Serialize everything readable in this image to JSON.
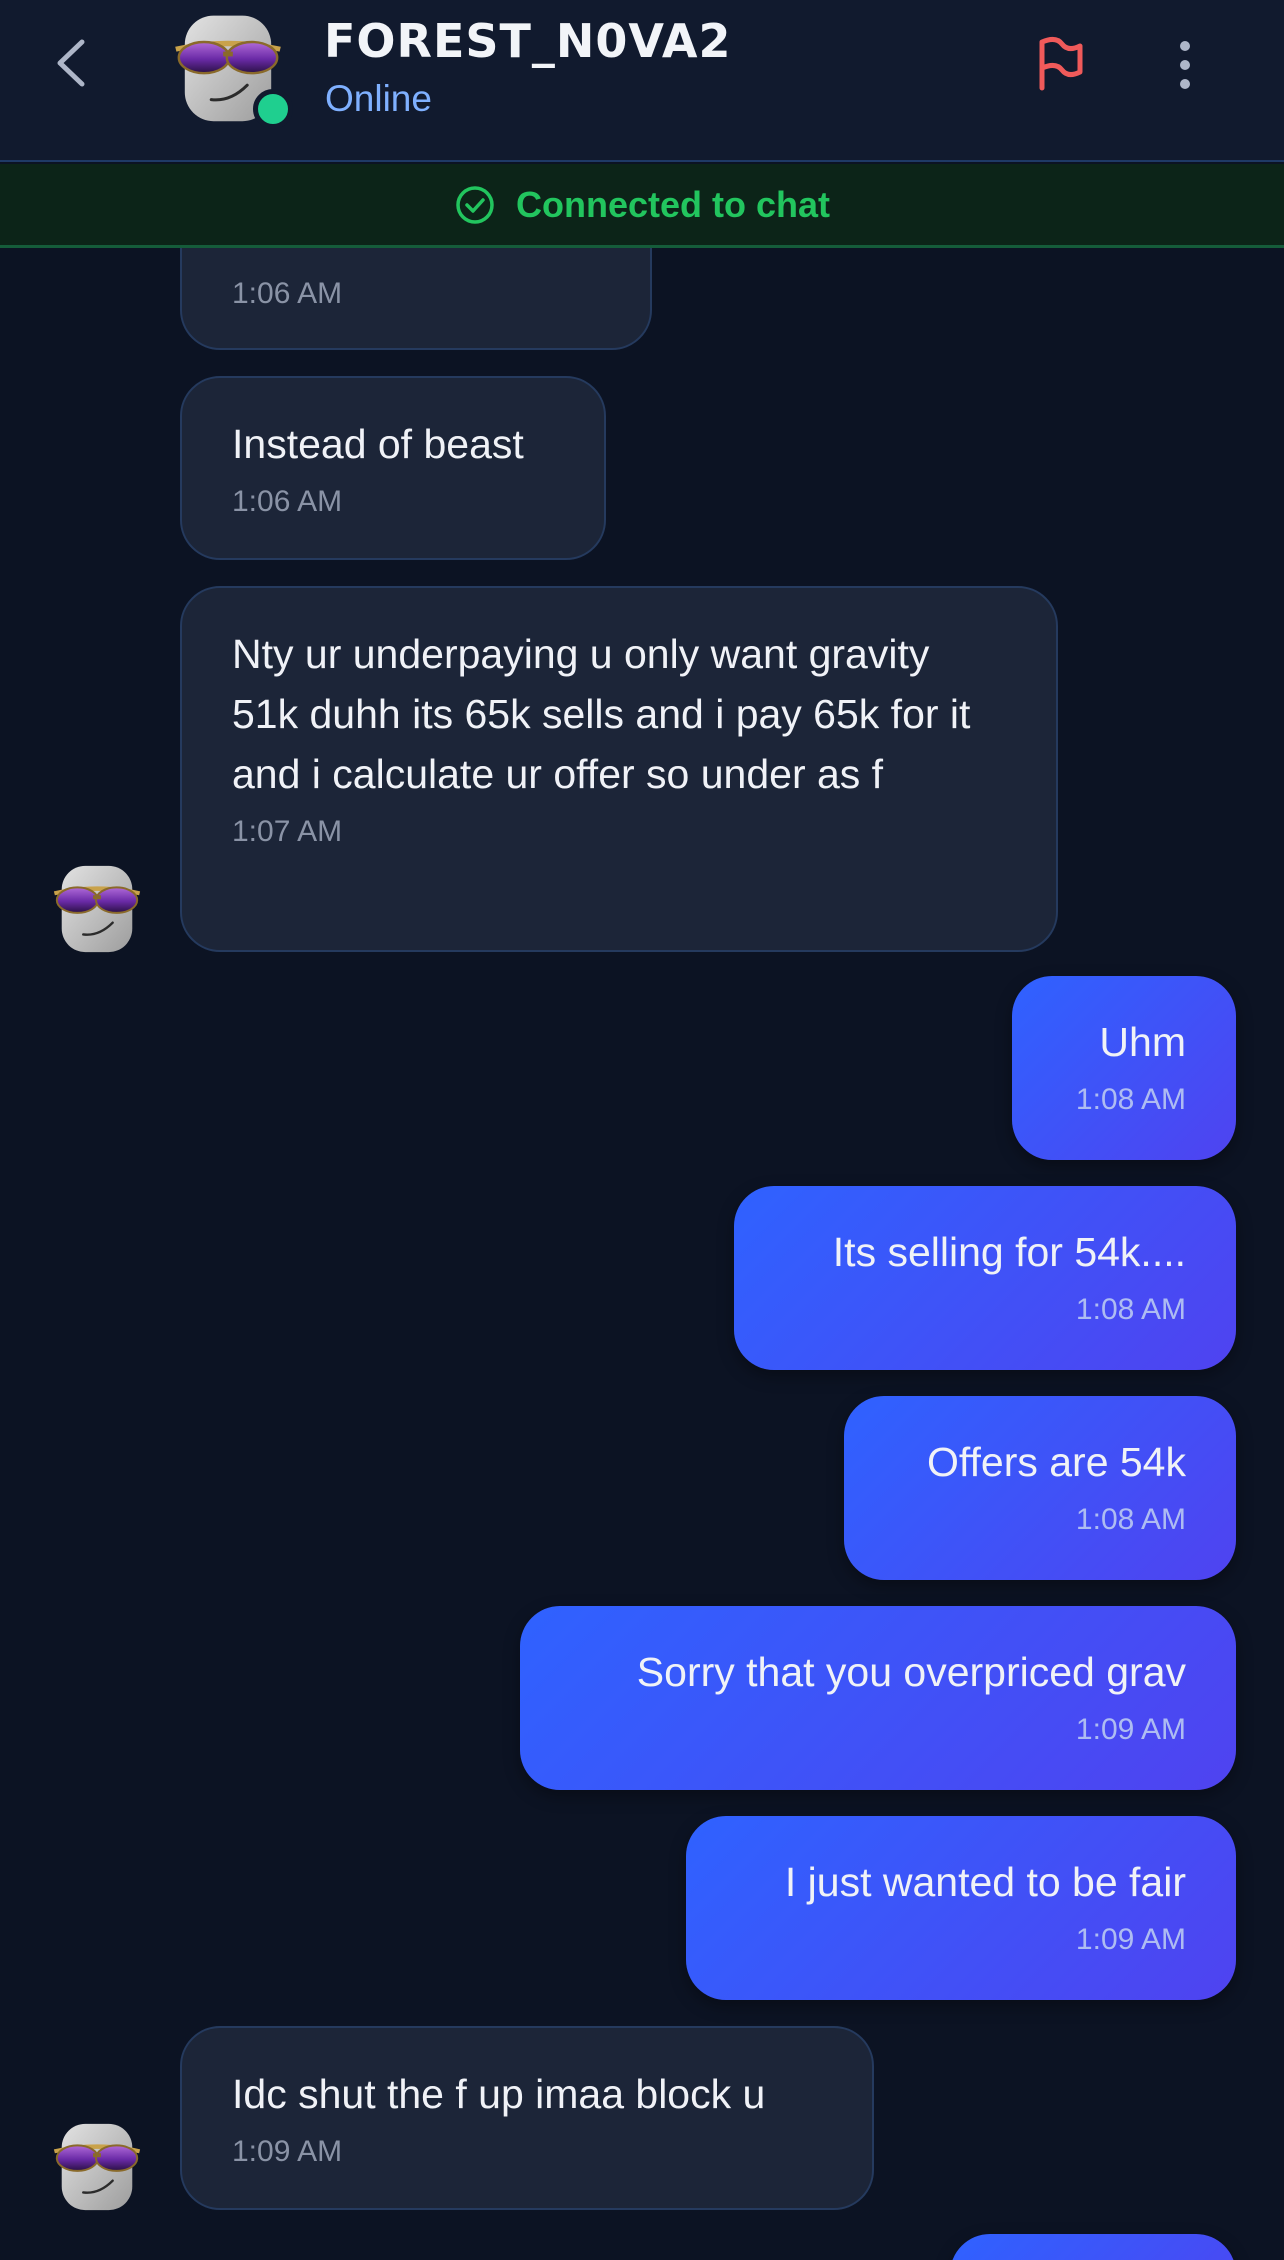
{
  "header": {
    "username": "FOREST_N0VA2",
    "status": "Online",
    "colors": {
      "online": "#1fcf8f",
      "status_text": "#7fb0ff",
      "flag": "#f05a5a"
    }
  },
  "banner": {
    "text": "Connected to chat",
    "color": "#22c55e"
  },
  "messages": [
    {
      "direction": "incoming",
      "text": "",
      "time": "1:06 AM"
    },
    {
      "direction": "incoming",
      "text": "Instead of beast",
      "time": "1:06 AM"
    },
    {
      "direction": "incoming",
      "text": "Nty ur underpaying u only want gravity  51k duhh its 65k sells and i pay 65k for it and i calculate ur offer so under as f",
      "time": "1:07 AM"
    },
    {
      "direction": "outgoing",
      "text": "Uhm",
      "time": "1:08 AM"
    },
    {
      "direction": "outgoing",
      "text": "Its selling for 54k....",
      "time": "1:08 AM"
    },
    {
      "direction": "outgoing",
      "text": "Offers are 54k",
      "time": "1:08 AM"
    },
    {
      "direction": "outgoing",
      "text": "Sorry that you overpriced grav",
      "time": "1:09 AM"
    },
    {
      "direction": "outgoing",
      "text": "I just wanted to be fair",
      "time": "1:09 AM"
    },
    {
      "direction": "incoming",
      "text": "Idc shut the f up imaa block u",
      "time": "1:09 AM"
    }
  ]
}
